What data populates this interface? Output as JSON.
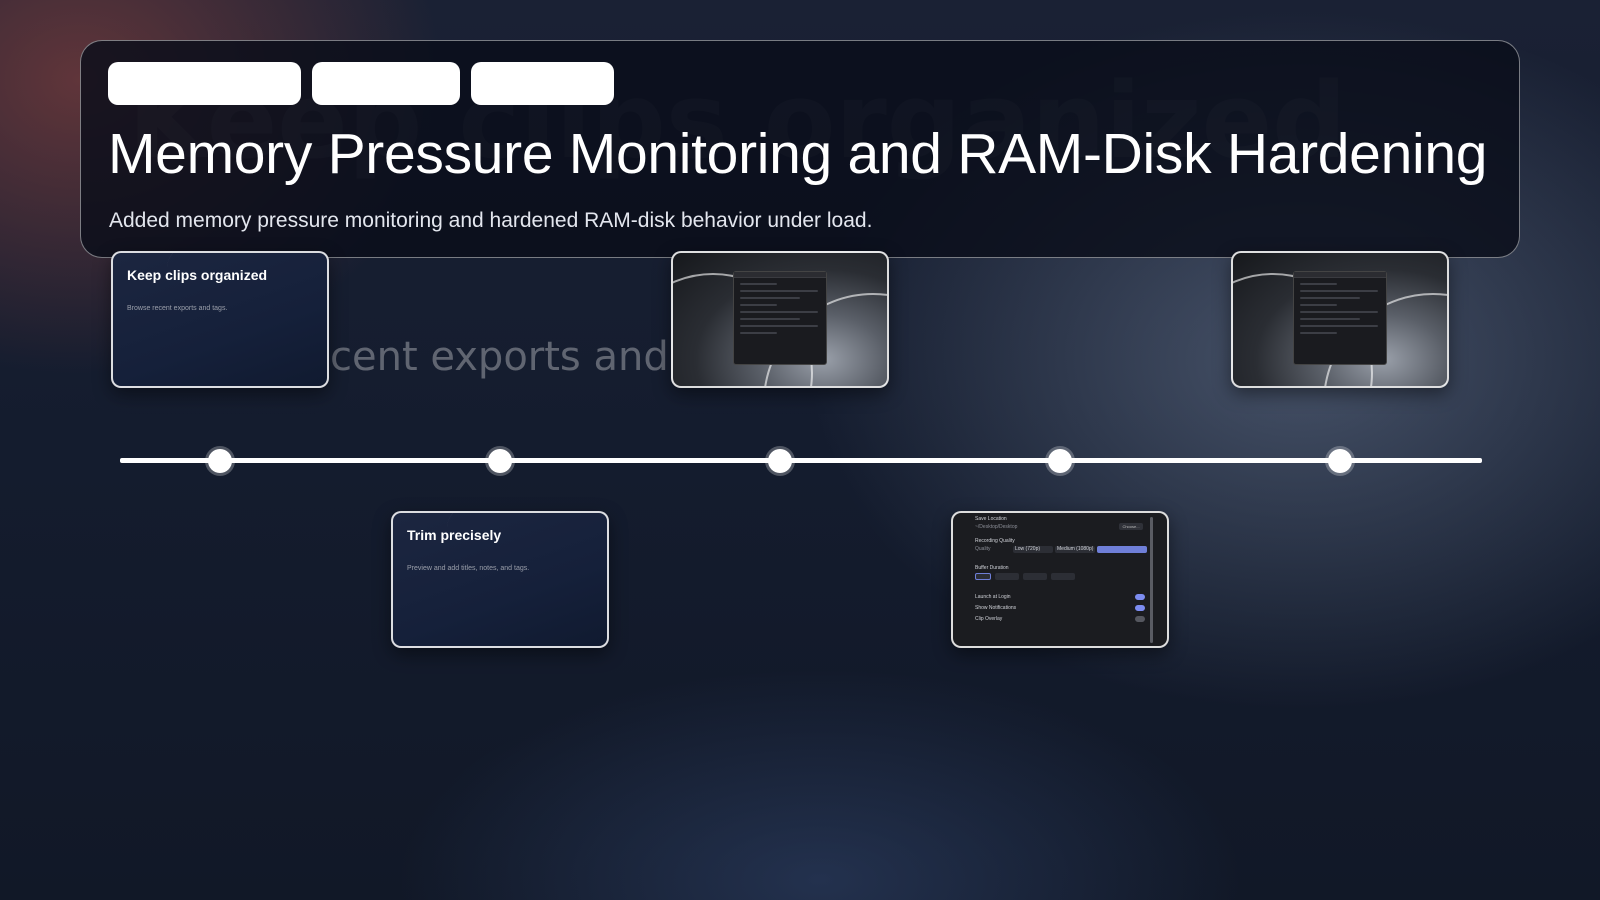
{
  "background_text": {
    "title": "Keep clips organized",
    "subtitle": "cent exports and"
  },
  "header": {
    "title": "Memory Pressure Monitoring and RAM-Disk Hardening",
    "description": "Added memory pressure monitoring and hardened RAM-disk behavior under load."
  },
  "cards": {
    "keep_clips": {
      "title": "Keep clips organized",
      "subtitle": "Browse recent exports and tags."
    },
    "trim": {
      "title": "Trim precisely",
      "subtitle": "Preview and add titles, notes, and tags."
    },
    "settings": {
      "save_location": "Save Location",
      "save_path": "~/Desktop/Desktop",
      "choose": "Choose...",
      "recording_quality": "Recording Quality",
      "quality": "Quality",
      "low": "Low (720p)",
      "medium": "Medium (1080p)",
      "buffer_duration": "Buffer Duration",
      "launch_at_login": "Launch at Login",
      "show_notifications": "Show Notifications",
      "clip_overlay": "Clip Overlay"
    }
  },
  "colors": {
    "accent": "#7c8cf0",
    "card_border": "#ffffff",
    "header_bg": "#0a0e1a"
  }
}
